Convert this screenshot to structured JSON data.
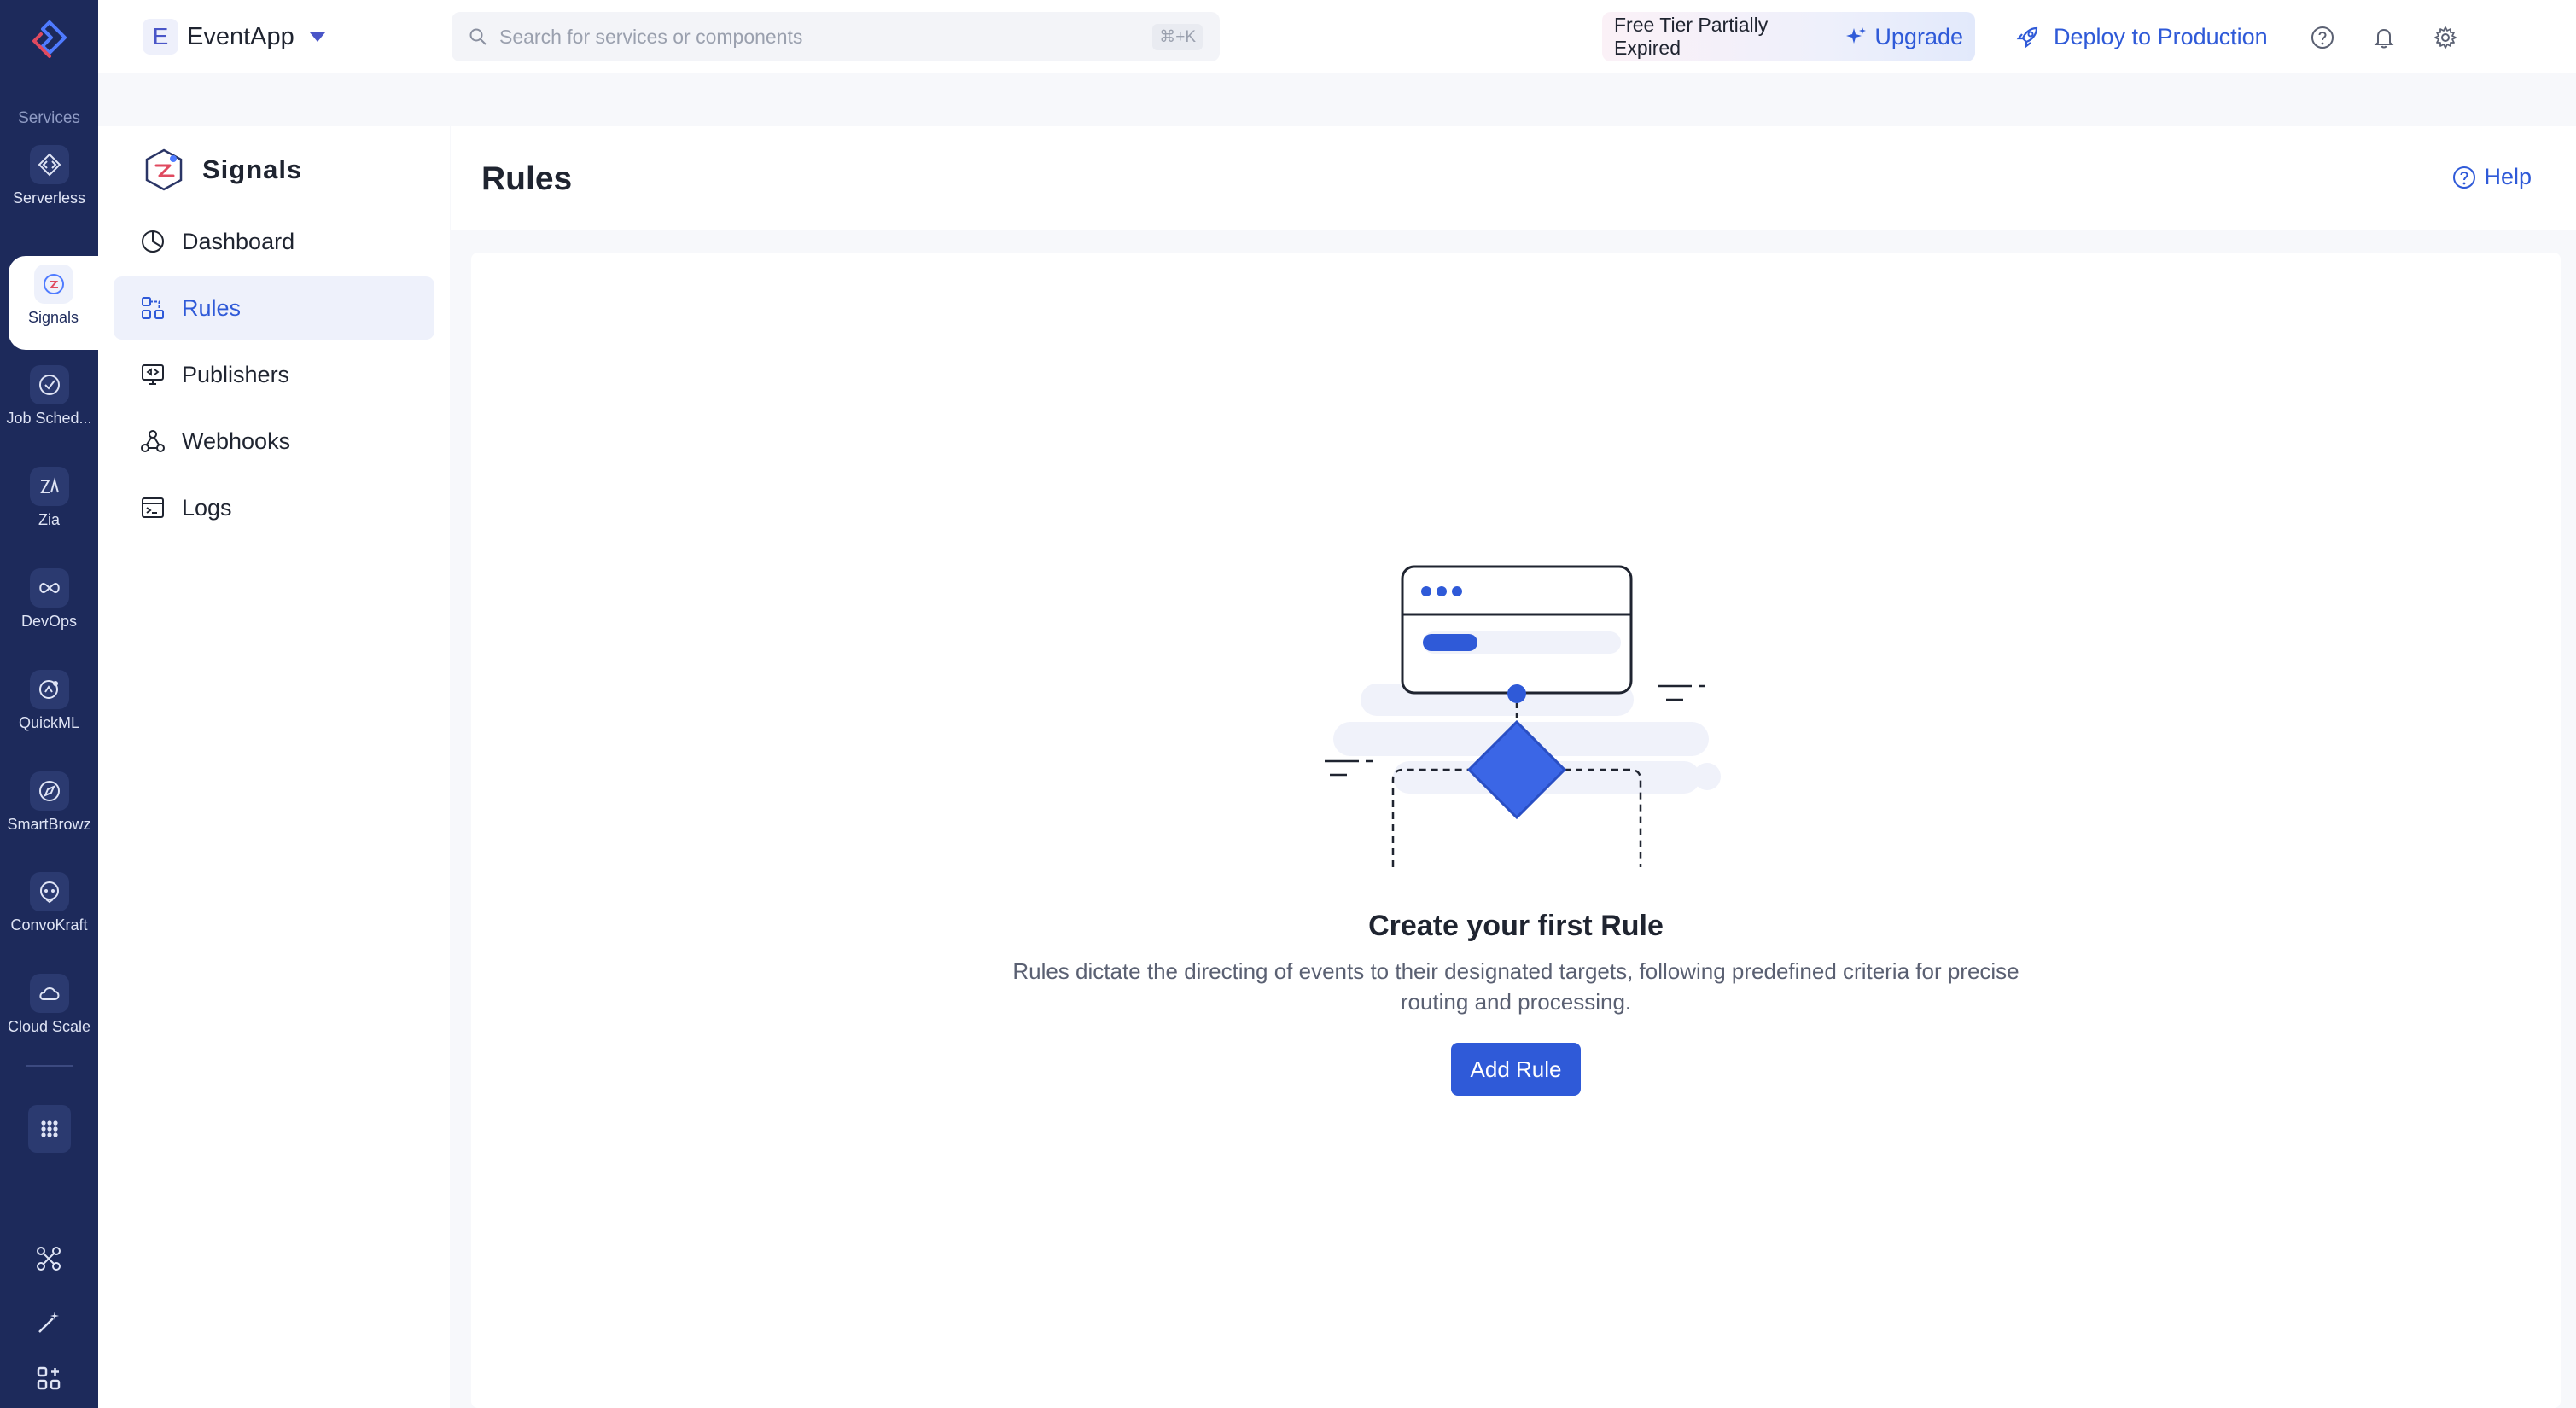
{
  "rail": {
    "section_label": "Services",
    "items": [
      {
        "label": "Serverless",
        "icon": "code-icon"
      },
      {
        "label": "Signals",
        "icon": "signals-icon"
      },
      {
        "label": "Job Sched...",
        "icon": "check-circle-icon"
      },
      {
        "label": "Zia",
        "icon": "zia-icon"
      },
      {
        "label": "DevOps",
        "icon": "infinity-icon"
      },
      {
        "label": "QuickML",
        "icon": "ml-icon"
      },
      {
        "label": "SmartBrowz",
        "icon": "compass-icon"
      },
      {
        "label": "ConvoKraft",
        "icon": "bot-icon"
      },
      {
        "label": "Cloud Scale",
        "icon": "cloud-icon"
      }
    ]
  },
  "header": {
    "app_initial": "E",
    "app_name": "EventApp",
    "search_placeholder": "Search for services or components",
    "search_shortcut": "⌘+K",
    "tier_text": "Free Tier Partially Expired",
    "upgrade_label": "Upgrade",
    "deploy_label": "Deploy to Production"
  },
  "service_nav": {
    "title": "Signals",
    "items": [
      {
        "label": "Dashboard",
        "icon": "dashboard-icon"
      },
      {
        "label": "Rules",
        "icon": "rules-icon",
        "active": true
      },
      {
        "label": "Publishers",
        "icon": "publishers-icon"
      },
      {
        "label": "Webhooks",
        "icon": "webhook-icon"
      },
      {
        "label": "Logs",
        "icon": "terminal-icon"
      }
    ]
  },
  "page": {
    "title": "Rules",
    "help_label": "Help"
  },
  "empty_state": {
    "title": "Create your first Rule",
    "description": "Rules dictate the directing of events to their designated targets, following predefined criteria for precise routing and processing.",
    "button_label": "Add Rule"
  },
  "colors": {
    "rail_bg": "#1d2a5b",
    "accent": "#2f5ad8",
    "active_nav_bg": "#eef1fb"
  }
}
